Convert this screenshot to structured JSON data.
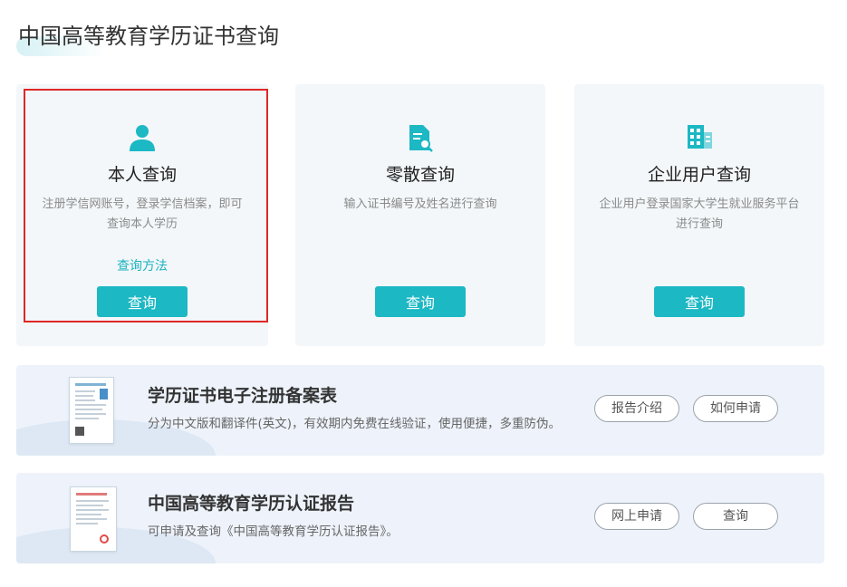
{
  "page": {
    "title": "中国高等教育学历证书查询"
  },
  "cards": [
    {
      "title": "本人查询",
      "desc": "注册学信网账号，登录学信档案，即可查询本人学历",
      "link": "查询方法",
      "button": "查询",
      "icon": "user-icon"
    },
    {
      "title": "零散查询",
      "desc": "输入证书编号及姓名进行查询",
      "button": "查询",
      "icon": "document-search-icon"
    },
    {
      "title": "企业用户查询",
      "desc": "企业用户登录国家大学生就业服务平台进行查询",
      "button": "查询",
      "icon": "building-icon"
    }
  ],
  "banners": [
    {
      "title": "学历证书电子注册备案表",
      "desc": "分为中文版和翻译件(英文)，有效期内免费在线验证，使用便捷，多重防伪。",
      "buttons": [
        "报告介绍",
        "如何申请"
      ]
    },
    {
      "title": "中国高等教育学历认证报告",
      "desc": "可申请及查询《中国高等教育学历认证报告》。",
      "buttons": [
        "网上申请",
        "查询"
      ]
    }
  ],
  "colors": {
    "accent": "#1cb8c4",
    "highlight": "#e02727",
    "card_bg": "#f3f7fa",
    "banner_bg": "#eef3fb"
  }
}
